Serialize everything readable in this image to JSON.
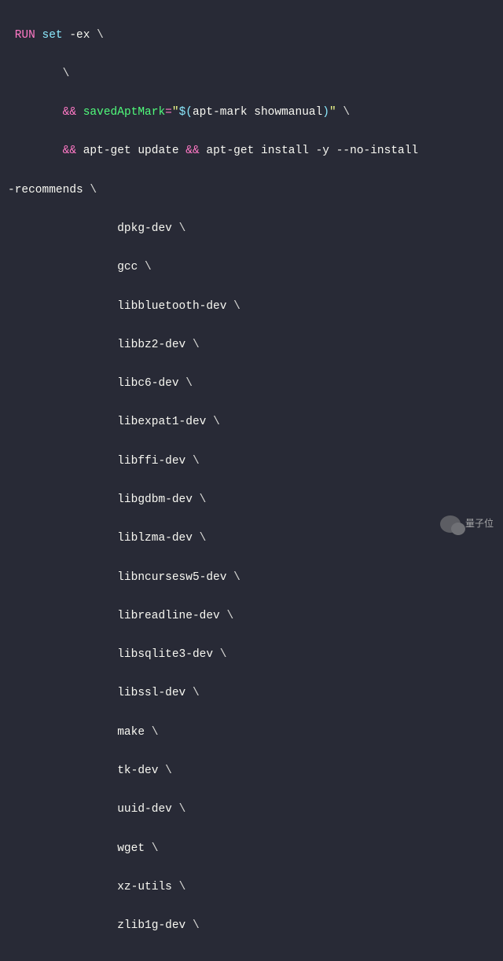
{
  "code": {
    "keyword_run": "RUN",
    "builtin_set": "set",
    "set_flags": "-ex",
    "var_name": "savedAptMark",
    "equals": "=",
    "quote": "\"",
    "subst_open": "$(",
    "subst_cmd": "apt-mark showmanual",
    "subst_close": ")",
    "aptget_update": "apt-get update",
    "aptget_install": "apt-get install",
    "install_flags": "-y --no-install",
    "recommends": "-recommends",
    "amp": "&&",
    "backslash": "\\",
    "packages": [
      "dpkg-dev",
      "gcc",
      "libbluetooth-dev",
      "libbz2-dev",
      "libc6-dev",
      "libexpat1-dev",
      "libffi-dev",
      "libgdbm-dev",
      "liblzma-dev",
      "libncursesw5-dev",
      "libreadline-dev",
      "libsqlite3-dev",
      "libssl-dev",
      "make",
      "tk-dev",
      "uuid-dev",
      "wget",
      "xz-utils",
      "zlib1g-dev"
    ]
  },
  "watermark": {
    "text": "量子位"
  }
}
